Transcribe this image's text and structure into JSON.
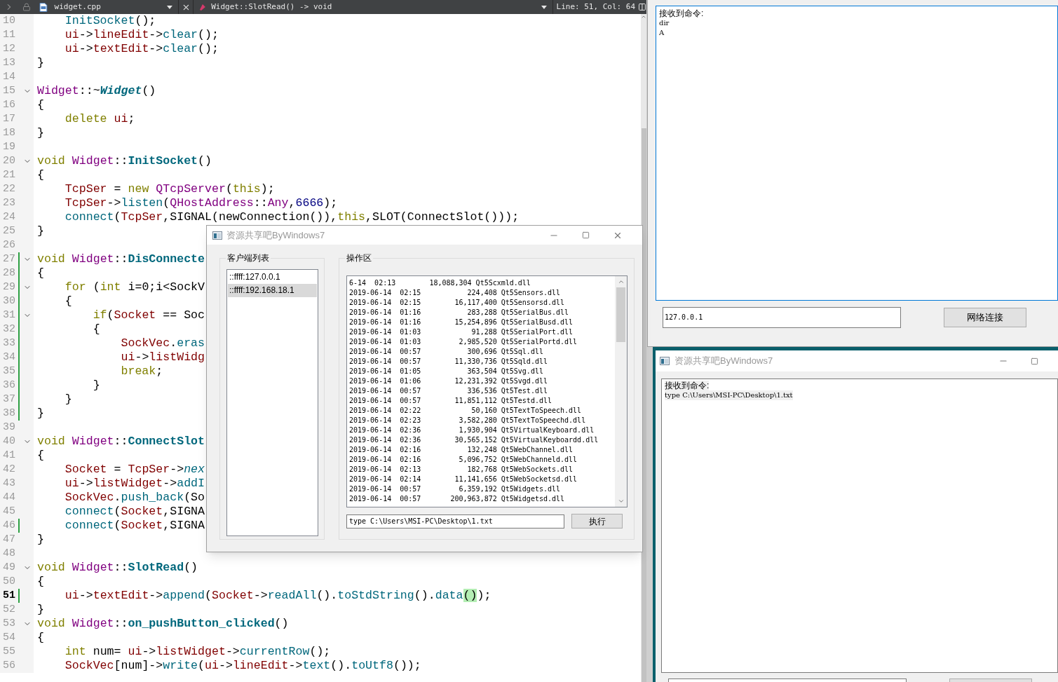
{
  "editor": {
    "toolbar": {
      "file": "widget.cpp",
      "symbol": "Widget::SlotRead() -> void",
      "position": "Line: 51, Col: 64"
    },
    "lines": [
      {
        "n": "10",
        "fold": false,
        "current": false,
        "modified": false,
        "tokens": [
          {
            "kind": "f",
            "text": "    InitSocket"
          },
          {
            "kind": "p",
            "text": "();"
          }
        ]
      },
      {
        "n": "11",
        "fold": false,
        "current": false,
        "modified": false,
        "tokens": [
          {
            "kind": "m",
            "text": "    ui"
          },
          {
            "kind": "p",
            "text": "->"
          },
          {
            "kind": "m",
            "text": "lineEdit"
          },
          {
            "kind": "p",
            "text": "->"
          },
          {
            "kind": "f",
            "text": "clear"
          },
          {
            "kind": "p",
            "text": "();"
          }
        ]
      },
      {
        "n": "12",
        "fold": false,
        "current": false,
        "modified": false,
        "tokens": [
          {
            "kind": "m",
            "text": "    ui"
          },
          {
            "kind": "p",
            "text": "->"
          },
          {
            "kind": "m",
            "text": "textEdit"
          },
          {
            "kind": "p",
            "text": "->"
          },
          {
            "kind": "f",
            "text": "clear"
          },
          {
            "kind": "p",
            "text": "();"
          }
        ]
      },
      {
        "n": "13",
        "fold": false,
        "current": false,
        "modified": false,
        "tokens": [
          {
            "kind": "p",
            "text": "}"
          }
        ]
      },
      {
        "n": "14",
        "fold": false,
        "current": false,
        "modified": false
      },
      {
        "n": "15",
        "fold": true,
        "current": false,
        "modified": false,
        "tokens": [
          {
            "kind": "t",
            "text": "Widget"
          },
          {
            "kind": "p",
            "text": "::~"
          },
          {
            "kind": "i",
            "text": "Widget"
          },
          {
            "kind": "p",
            "text": "()"
          }
        ]
      },
      {
        "n": "16",
        "fold": false,
        "current": false,
        "modified": false,
        "tokens": [
          {
            "kind": "p",
            "text": "{"
          }
        ]
      },
      {
        "n": "17",
        "fold": false,
        "current": false,
        "modified": false,
        "tokens": [
          {
            "kind": "k",
            "text": "    delete "
          },
          {
            "kind": "m",
            "text": "ui"
          },
          {
            "kind": "p",
            "text": ";"
          }
        ]
      },
      {
        "n": "18",
        "fold": false,
        "current": false,
        "modified": false,
        "tokens": [
          {
            "kind": "p",
            "text": "}"
          }
        ]
      },
      {
        "n": "19",
        "fold": false,
        "current": false,
        "modified": false
      },
      {
        "n": "20",
        "fold": true,
        "current": false,
        "modified": false,
        "tokens": [
          {
            "kind": "k",
            "text": "void "
          },
          {
            "kind": "t",
            "text": "Widget"
          },
          {
            "kind": "p",
            "text": "::"
          },
          {
            "kind": "d",
            "text": "InitSocket"
          },
          {
            "kind": "p",
            "text": "()"
          }
        ]
      },
      {
        "n": "21",
        "fold": false,
        "current": false,
        "modified": false,
        "tokens": [
          {
            "kind": "p",
            "text": "{"
          }
        ]
      },
      {
        "n": "22",
        "fold": false,
        "current": false,
        "modified": false,
        "tokens": [
          {
            "kind": "m",
            "text": "    TcpSer"
          },
          {
            "kind": "p",
            "text": " = "
          },
          {
            "kind": "k",
            "text": "new "
          },
          {
            "kind": "t",
            "text": "QTcpServer"
          },
          {
            "kind": "p",
            "text": "("
          },
          {
            "kind": "k",
            "text": "this"
          },
          {
            "kind": "p",
            "text": ");"
          }
        ]
      },
      {
        "n": "23",
        "fold": false,
        "current": false,
        "modified": false,
        "tokens": [
          {
            "kind": "m",
            "text": "    TcpSer"
          },
          {
            "kind": "p",
            "text": "->"
          },
          {
            "kind": "f",
            "text": "listen"
          },
          {
            "kind": "p",
            "text": "("
          },
          {
            "kind": "t",
            "text": "QHostAddress"
          },
          {
            "kind": "p",
            "text": "::"
          },
          {
            "kind": "t",
            "text": "Any"
          },
          {
            "kind": "p",
            "text": ","
          },
          {
            "kind": "n",
            "text": "6666"
          },
          {
            "kind": "p",
            "text": ");"
          }
        ]
      },
      {
        "n": "24",
        "fold": false,
        "current": false,
        "modified": false,
        "tokens": [
          {
            "kind": "f",
            "text": "    connect"
          },
          {
            "kind": "p",
            "text": "("
          },
          {
            "kind": "m",
            "text": "TcpSer"
          },
          {
            "kind": "p",
            "text": ",SIGNAL(newConnection()),"
          },
          {
            "kind": "k",
            "text": "this"
          },
          {
            "kind": "p",
            "text": ",SLOT(ConnectSlot()));"
          }
        ]
      },
      {
        "n": "25",
        "fold": false,
        "current": false,
        "modified": false,
        "tokens": [
          {
            "kind": "p",
            "text": "}"
          }
        ]
      },
      {
        "n": "26",
        "fold": false,
        "current": false,
        "modified": false
      },
      {
        "n": "27",
        "fold": true,
        "current": false,
        "modified": true,
        "tokens": [
          {
            "kind": "k",
            "text": "void "
          },
          {
            "kind": "t",
            "text": "Widget"
          },
          {
            "kind": "p",
            "text": "::"
          },
          {
            "kind": "d",
            "text": "DisConnecte"
          }
        ]
      },
      {
        "n": "28",
        "fold": false,
        "current": false,
        "modified": true,
        "tokens": [
          {
            "kind": "p",
            "text": "{"
          }
        ]
      },
      {
        "n": "29",
        "fold": true,
        "current": false,
        "modified": true,
        "tokens": [
          {
            "kind": "k",
            "text": "    for"
          },
          {
            "kind": "p",
            "text": " ("
          },
          {
            "kind": "k",
            "text": "int"
          },
          {
            "kind": "p",
            "text": " i=0;i<SockV"
          }
        ]
      },
      {
        "n": "30",
        "fold": false,
        "current": false,
        "modified": true,
        "tokens": [
          {
            "kind": "p",
            "text": "    {"
          }
        ]
      },
      {
        "n": "31",
        "fold": true,
        "current": false,
        "modified": true,
        "tokens": [
          {
            "kind": "k",
            "text": "        if"
          },
          {
            "kind": "p",
            "text": "("
          },
          {
            "kind": "m",
            "text": "Socket"
          },
          {
            "kind": "p",
            "text": " == Soc"
          }
        ]
      },
      {
        "n": "32",
        "fold": false,
        "current": false,
        "modified": true,
        "tokens": [
          {
            "kind": "p",
            "text": "        {"
          }
        ]
      },
      {
        "n": "33",
        "fold": false,
        "current": false,
        "modified": true,
        "tokens": [
          {
            "kind": "m",
            "text": "            SockVec"
          },
          {
            "kind": "p",
            "text": "."
          },
          {
            "kind": "f",
            "text": "eras"
          }
        ]
      },
      {
        "n": "34",
        "fold": false,
        "current": false,
        "modified": true,
        "tokens": [
          {
            "kind": "m",
            "text": "            ui"
          },
          {
            "kind": "p",
            "text": "->"
          },
          {
            "kind": "m",
            "text": "listWidg"
          }
        ]
      },
      {
        "n": "35",
        "fold": false,
        "current": false,
        "modified": true,
        "tokens": [
          {
            "kind": "k",
            "text": "            break"
          },
          {
            "kind": "p",
            "text": ";"
          }
        ]
      },
      {
        "n": "36",
        "fold": false,
        "current": false,
        "modified": true,
        "tokens": [
          {
            "kind": "p",
            "text": "        }"
          }
        ]
      },
      {
        "n": "37",
        "fold": false,
        "current": false,
        "modified": true,
        "tokens": [
          {
            "kind": "p",
            "text": "    }"
          }
        ]
      },
      {
        "n": "38",
        "fold": false,
        "current": false,
        "modified": true,
        "tokens": [
          {
            "kind": "p",
            "text": "}"
          }
        ]
      },
      {
        "n": "39",
        "fold": false,
        "current": false,
        "modified": false
      },
      {
        "n": "40",
        "fold": true,
        "current": false,
        "modified": false,
        "tokens": [
          {
            "kind": "k",
            "text": "void "
          },
          {
            "kind": "t",
            "text": "Widget"
          },
          {
            "kind": "p",
            "text": "::"
          },
          {
            "kind": "d",
            "text": "ConnectSlot"
          }
        ]
      },
      {
        "n": "41",
        "fold": false,
        "current": false,
        "modified": false,
        "tokens": [
          {
            "kind": "p",
            "text": "{"
          }
        ]
      },
      {
        "n": "42",
        "fold": false,
        "current": false,
        "modified": false,
        "tokens": [
          {
            "kind": "m",
            "text": "    Socket"
          },
          {
            "kind": "p",
            "text": " = "
          },
          {
            "kind": "m",
            "text": "TcpSer"
          },
          {
            "kind": "p",
            "text": "->"
          },
          {
            "kind": "e",
            "text": "nex"
          }
        ]
      },
      {
        "n": "43",
        "fold": false,
        "current": false,
        "modified": false,
        "tokens": [
          {
            "kind": "m",
            "text": "    ui"
          },
          {
            "kind": "p",
            "text": "->"
          },
          {
            "kind": "m",
            "text": "listWidget"
          },
          {
            "kind": "p",
            "text": "->"
          },
          {
            "kind": "f",
            "text": "addI"
          }
        ]
      },
      {
        "n": "44",
        "fold": false,
        "current": false,
        "modified": false,
        "tokens": [
          {
            "kind": "m",
            "text": "    SockVec"
          },
          {
            "kind": "p",
            "text": "."
          },
          {
            "kind": "f",
            "text": "push_back"
          },
          {
            "kind": "p",
            "text": "(So"
          }
        ]
      },
      {
        "n": "45",
        "fold": false,
        "current": false,
        "modified": false,
        "tokens": [
          {
            "kind": "f",
            "text": "    connect"
          },
          {
            "kind": "p",
            "text": "("
          },
          {
            "kind": "m",
            "text": "Socket"
          },
          {
            "kind": "p",
            "text": ",SIGNA"
          }
        ]
      },
      {
        "n": "46",
        "fold": false,
        "current": false,
        "modified": true,
        "tokens": [
          {
            "kind": "f",
            "text": "    connect"
          },
          {
            "kind": "p",
            "text": "("
          },
          {
            "kind": "m",
            "text": "Socket"
          },
          {
            "kind": "p",
            "text": ",SIGNA"
          }
        ]
      },
      {
        "n": "47",
        "fold": false,
        "current": false,
        "modified": false,
        "tokens": [
          {
            "kind": "p",
            "text": "}"
          }
        ]
      },
      {
        "n": "48",
        "fold": false,
        "current": false,
        "modified": false
      },
      {
        "n": "49",
        "fold": true,
        "current": false,
        "modified": false,
        "tokens": [
          {
            "kind": "k",
            "text": "void "
          },
          {
            "kind": "t",
            "text": "Widget"
          },
          {
            "kind": "p",
            "text": "::"
          },
          {
            "kind": "d",
            "text": "SlotRead"
          },
          {
            "kind": "p",
            "text": "()"
          }
        ]
      },
      {
        "n": "50",
        "fold": false,
        "current": false,
        "modified": false,
        "tokens": [
          {
            "kind": "p",
            "text": "{"
          }
        ]
      },
      {
        "n": "51",
        "fold": false,
        "current": true,
        "modified": true,
        "tokens": [
          {
            "kind": "m",
            "text": "    ui"
          },
          {
            "kind": "p",
            "text": "->"
          },
          {
            "kind": "m",
            "text": "textEdit"
          },
          {
            "kind": "p",
            "text": "->"
          },
          {
            "kind": "f",
            "text": "append"
          },
          {
            "kind": "p",
            "text": "("
          },
          {
            "kind": "m",
            "text": "Socket"
          },
          {
            "kind": "p",
            "text": "->"
          },
          {
            "kind": "f",
            "text": "readAll"
          },
          {
            "kind": "p",
            "text": "()."
          },
          {
            "kind": "f",
            "text": "toStdString"
          },
          {
            "kind": "p",
            "text": "()."
          },
          {
            "kind": "f",
            "text": "data"
          },
          {
            "kind": "h",
            "text": "()"
          },
          {
            "kind": "p",
            "text": ");"
          }
        ]
      },
      {
        "n": "52",
        "fold": false,
        "current": false,
        "modified": false,
        "tokens": [
          {
            "kind": "p",
            "text": "}"
          }
        ]
      },
      {
        "n": "53",
        "fold": true,
        "current": false,
        "modified": false,
        "tokens": [
          {
            "kind": "k",
            "text": "void "
          },
          {
            "kind": "t",
            "text": "Widget"
          },
          {
            "kind": "p",
            "text": "::"
          },
          {
            "kind": "d",
            "text": "on_pushButton_clicked"
          },
          {
            "kind": "p",
            "text": "()"
          }
        ]
      },
      {
        "n": "54",
        "fold": false,
        "current": false,
        "modified": false,
        "tokens": [
          {
            "kind": "p",
            "text": "{"
          }
        ]
      },
      {
        "n": "55",
        "fold": false,
        "current": false,
        "modified": false,
        "tokens": [
          {
            "kind": "k",
            "text": "    int"
          },
          {
            "kind": "p",
            "text": " num= "
          },
          {
            "kind": "m",
            "text": "ui"
          },
          {
            "kind": "p",
            "text": "->"
          },
          {
            "kind": "m",
            "text": "listWidget"
          },
          {
            "kind": "p",
            "text": "->"
          },
          {
            "kind": "f",
            "text": "currentRow"
          },
          {
            "kind": "p",
            "text": "();"
          }
        ]
      },
      {
        "n": "56",
        "fold": false,
        "current": false,
        "modified": false,
        "tokens": [
          {
            "kind": "m",
            "text": "    SockVec"
          },
          {
            "kind": "p",
            "text": "[num]->"
          },
          {
            "kind": "f",
            "text": "write"
          },
          {
            "kind": "p",
            "text": "("
          },
          {
            "kind": "m",
            "text": "ui"
          },
          {
            "kind": "p",
            "text": "->"
          },
          {
            "kind": "m",
            "text": "lineEdit"
          },
          {
            "kind": "p",
            "text": "->"
          },
          {
            "kind": "f",
            "text": "text"
          },
          {
            "kind": "p",
            "text": "()."
          },
          {
            "kind": "f",
            "text": "toUtf8"
          },
          {
            "kind": "p",
            "text": "());"
          }
        ]
      }
    ]
  },
  "server_window": {
    "title": "资源共享吧ByWindows7",
    "clients": {
      "title": "客户端列表",
      "items": [
        {
          "label": "::ffff:127.0.0.1",
          "selected": false
        },
        {
          "label": "::ffff:192.168.18.1",
          "selected": true
        }
      ]
    },
    "operations": {
      "title": "操作区",
      "output": [
        "6-14  02:13        18,088,304 Qt5Scxmld.dll",
        "2019-06-14  02:15           224,408 Qt5Sensors.dll",
        "2019-06-14  02:15        16,117,400 Qt5Sensorsd.dll",
        "2019-06-14  01:16           283,288 Qt5SerialBus.dll",
        "2019-06-14  01:16        15,254,896 Qt5SerialBusd.dll",
        "2019-06-14  01:03            91,288 Qt5SerialPort.dll",
        "2019-06-14  01:03         2,985,520 Qt5SerialPortd.dll",
        "2019-06-14  00:57           300,696 Qt5Sql.dll",
        "2019-06-14  00:57        11,330,736 Qt5Sqld.dll",
        "2019-06-14  01:05           363,504 Qt5Svg.dll",
        "2019-06-14  01:06        12,231,392 Qt5Svgd.dll",
        "2019-06-14  00:57           336,536 Qt5Test.dll",
        "2019-06-14  00:57        11,851,112 Qt5Testd.dll",
        "2019-06-14  02:22            50,160 Qt5TextToSpeech.dll",
        "2019-06-14  02:23         3,582,280 Qt5TextToSpeechd.dll",
        "2019-06-14  02:36         1,930,904 Qt5VirtualKeyboard.dll",
        "2019-06-14  02:36        30,565,152 Qt5VirtualKeyboardd.dll",
        "2019-06-14  02:16           132,248 Qt5WebChannel.dll",
        "2019-06-14  02:16         5,096,752 Qt5WebChanneld.dll",
        "2019-06-14  02:13           182,768 Qt5WebSockets.dll",
        "2019-06-14  02:14        11,141,656 Qt5WebSocketsd.dll",
        "2019-06-14  00:57         6,359,192 Qt5Widgets.dll",
        "2019-06-14  00:57       200,963,872 Qt5Widgetsd.dll"
      ],
      "command": "type C:\\Users\\MSI-PC\\Desktop\\1.txt",
      "run_button": "执行"
    }
  },
  "client_window_top": {
    "received_label": "接收到命令:",
    "received_lines": [
      "dir",
      "A"
    ],
    "address": "127.0.0.1",
    "connect_button": "网络连接"
  },
  "client_window_bottom": {
    "title": "资源共享吧ByWindows7",
    "received_label": "接收到命令:",
    "received_lines": [
      "type C:\\Users\\MSI-PC\\Desktop\\1.txt"
    ]
  }
}
